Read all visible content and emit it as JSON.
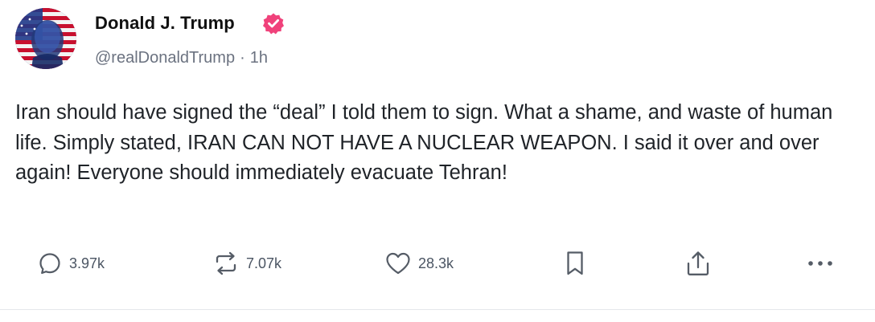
{
  "post": {
    "author": {
      "display_name": "Donald J. Trump",
      "handle": "@realDonaldTrump",
      "separator": "·",
      "time": "1h",
      "verified_icon": "verified-badge-icon",
      "verified_color": "#f0427b"
    },
    "text": "Iran should have signed the “deal” I told them to sign. What a shame, and waste of human life. Simply stated, IRAN CAN NOT HAVE A NUCLEAR WEAPON. I said it over and over again! Everyone should immediately evacuate Tehran!",
    "actions": {
      "reply": {
        "icon": "reply-icon",
        "count": "3.97k"
      },
      "repost": {
        "icon": "repost-icon",
        "count": "7.07k"
      },
      "like": {
        "icon": "heart-icon",
        "count": "28.3k"
      },
      "bookmark": {
        "icon": "bookmark-icon"
      },
      "share": {
        "icon": "share-icon"
      },
      "more": {
        "icon": "more-icon"
      }
    }
  }
}
